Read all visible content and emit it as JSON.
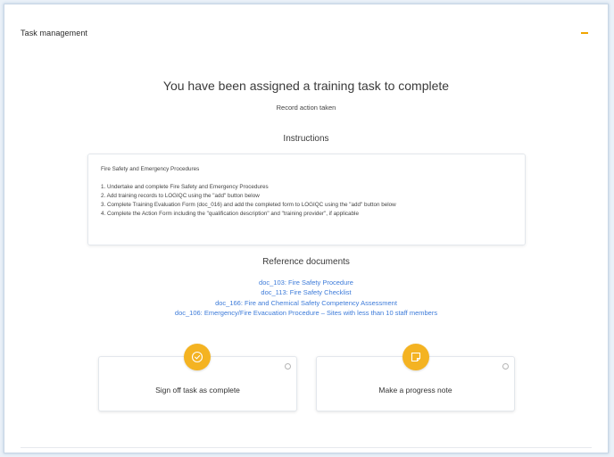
{
  "panel": {
    "title": "Task management"
  },
  "task": {
    "heading": "You have been assigned a training task to complete",
    "subtext": "Record action taken"
  },
  "instructions": {
    "section_title": "Instructions",
    "box_title": "Fire Safety and Emergency Procedures",
    "lines": [
      "1. Undertake and complete Fire Safety and Emergency Procedures",
      "2. Add training records to LOGIQC using the \"add\" button below",
      "3. Complete Training Evaluation Form (doc_016) and add the completed form to LOGIQC using the \"add\" button below",
      "4. Complete the Action Form including the \"qualification description\" and \"training provider\", if applicable"
    ]
  },
  "reference_documents": {
    "section_title": "Reference documents",
    "links": [
      "doc_103: Fire Safety Procedure",
      "doc_113: Fire Safety Checklist",
      "doc_166: Fire and Chemical Safety Competency Assessment",
      "doc_106: Emergency/Fire Evacuation Procedure – Sites with less than 10 staff members"
    ]
  },
  "actions": {
    "sign_off_label": "Sign off task as complete",
    "progress_note_label": "Make a progress note"
  },
  "colors": {
    "accent": "#f4b322",
    "link": "#3d7bd9",
    "collapse": "#f0a500"
  },
  "icons": {
    "collapse": "minus-icon",
    "sign_off": "check-circle-icon",
    "progress_note": "note-icon",
    "info": "info-icon"
  }
}
